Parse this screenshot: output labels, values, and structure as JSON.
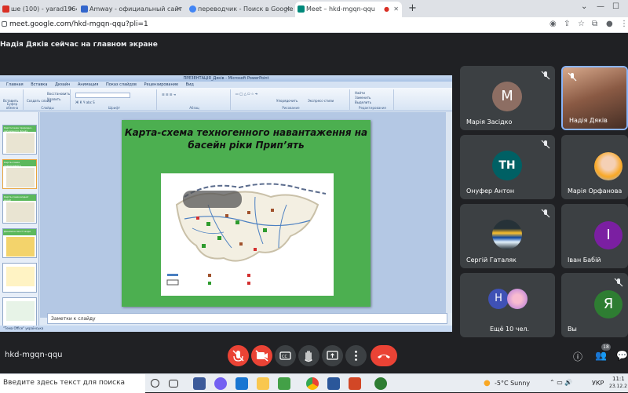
{
  "browser": {
    "tabs": [
      {
        "label": "ше (100) - yarad1964@gm",
        "icon_color": "#d93025"
      },
      {
        "label": "Amway - официальный сайт и и",
        "icon_color": "#3366cc"
      },
      {
        "label": "переводчик - Поиск в Google",
        "icon_color": "#4285f4"
      },
      {
        "label": "Meet – hkd-mgqn-qqu",
        "icon_color": "#00897b"
      }
    ],
    "new_tab": "+",
    "url": "meet.google.com/hkd-mgqn-qqu?pli=1"
  },
  "presentation_banner": "Надія Дяків сейчас на главном экране",
  "ppt": {
    "window_title": "ПРЕЗЕНТАЦІЯ_Дяків - Microsoft PowerPoint",
    "menu": [
      "Главная",
      "Вставка",
      "Дизайн",
      "Анимация",
      "Показ слайдов",
      "Рецензирование",
      "Вид"
    ],
    "ribbon_items": [
      "Вставить",
      "Создать слайд",
      "Восстановить",
      "Удалить",
      "Упорядочить",
      "Экспресс-стили",
      "Найти",
      "Заменить",
      "Выделить"
    ],
    "ribbon_groups": [
      "Буфер обмена",
      "Слайды",
      "Шрифт",
      "Абзац",
      "Рисование",
      "Редактирование"
    ],
    "thumbs": [
      "Картосхема природно-заповідного фонду",
      "Карта-схема техногенного навантаження",
      "Карта-схема водної ерозії",
      "Динаміка якості води"
    ],
    "slide_title": "Карта-схема техногенного навантаження на басейн ріки Прип’ять",
    "notes": "Заметки к слайду",
    "status": "\"Тема Office\"  українська"
  },
  "participants": [
    {
      "name": "Марія Засідко",
      "initial": "М",
      "avatar_color": "#8d6e63",
      "muted": true
    },
    {
      "name": "Надія Дяків",
      "initial": "",
      "avatar_color": "#6d4c41",
      "muted": true,
      "video": true
    },
    {
      "name": "Онуфер Антон",
      "initial": "TH",
      "avatar_color": "#006064",
      "muted": true
    },
    {
      "name": "Марія Орфанова",
      "initial": "",
      "avatar_color": "#f9a825",
      "muted": false
    },
    {
      "name": "Сергій Гаталяк",
      "initial": "",
      "avatar_color": "#263238",
      "muted": true
    },
    {
      "name": "Іван Бабій",
      "initial": "І",
      "avatar_color": "#7b1fa2",
      "muted": false
    },
    {
      "name": "Ещё 10 чел.",
      "initial": "Н",
      "avatar_color": "#3f51b5",
      "muted": false
    },
    {
      "name": "Вы",
      "initial": "Я",
      "avatar_color": "#2e7d32",
      "muted": true
    }
  ],
  "meeting_code": "hkd-mgqn-qqu",
  "people_count": "18",
  "taskbar": {
    "search_placeholder": "Введите здесь текст для поиска",
    "weather": "-5°C  Sunny",
    "lang": "УКР",
    "time": "11:1",
    "date": "23.12.2"
  },
  "colors": {
    "meet_bg": "#202124",
    "tile_bg": "#3c4043",
    "end_call": "#ea4335",
    "slide_green": "#4caf50"
  }
}
